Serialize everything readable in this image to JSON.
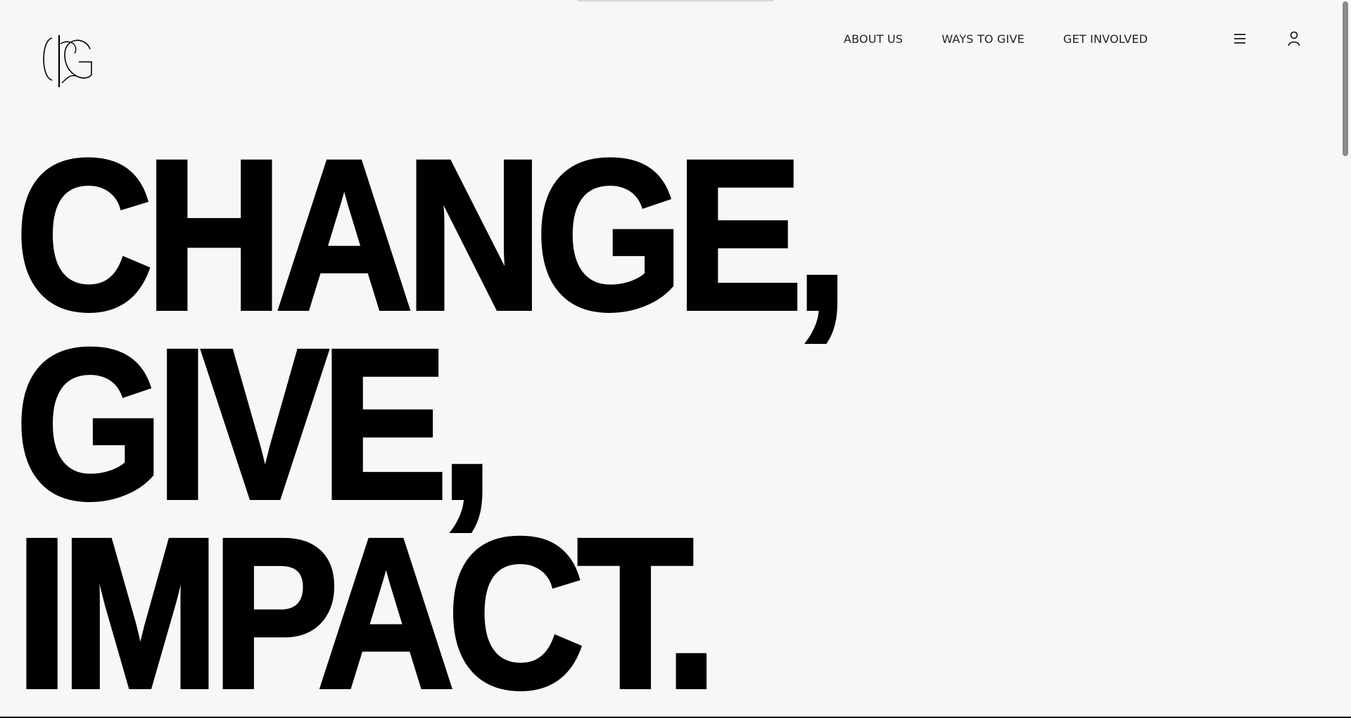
{
  "header": {
    "logo_text": "CIG",
    "nav": [
      {
        "label": "ABOUT US"
      },
      {
        "label": "WAYS TO GIVE"
      },
      {
        "label": "GET INVOLVED"
      }
    ],
    "menu_icon": "hamburger-menu-icon",
    "user_icon": "user-account-icon"
  },
  "hero": {
    "line1": "CHANGE,",
    "line2": "GIVE,",
    "line3": "IMPACT."
  },
  "colors": {
    "background": "#f7f7f7",
    "text": "#000000",
    "nav_text": "#222222"
  }
}
